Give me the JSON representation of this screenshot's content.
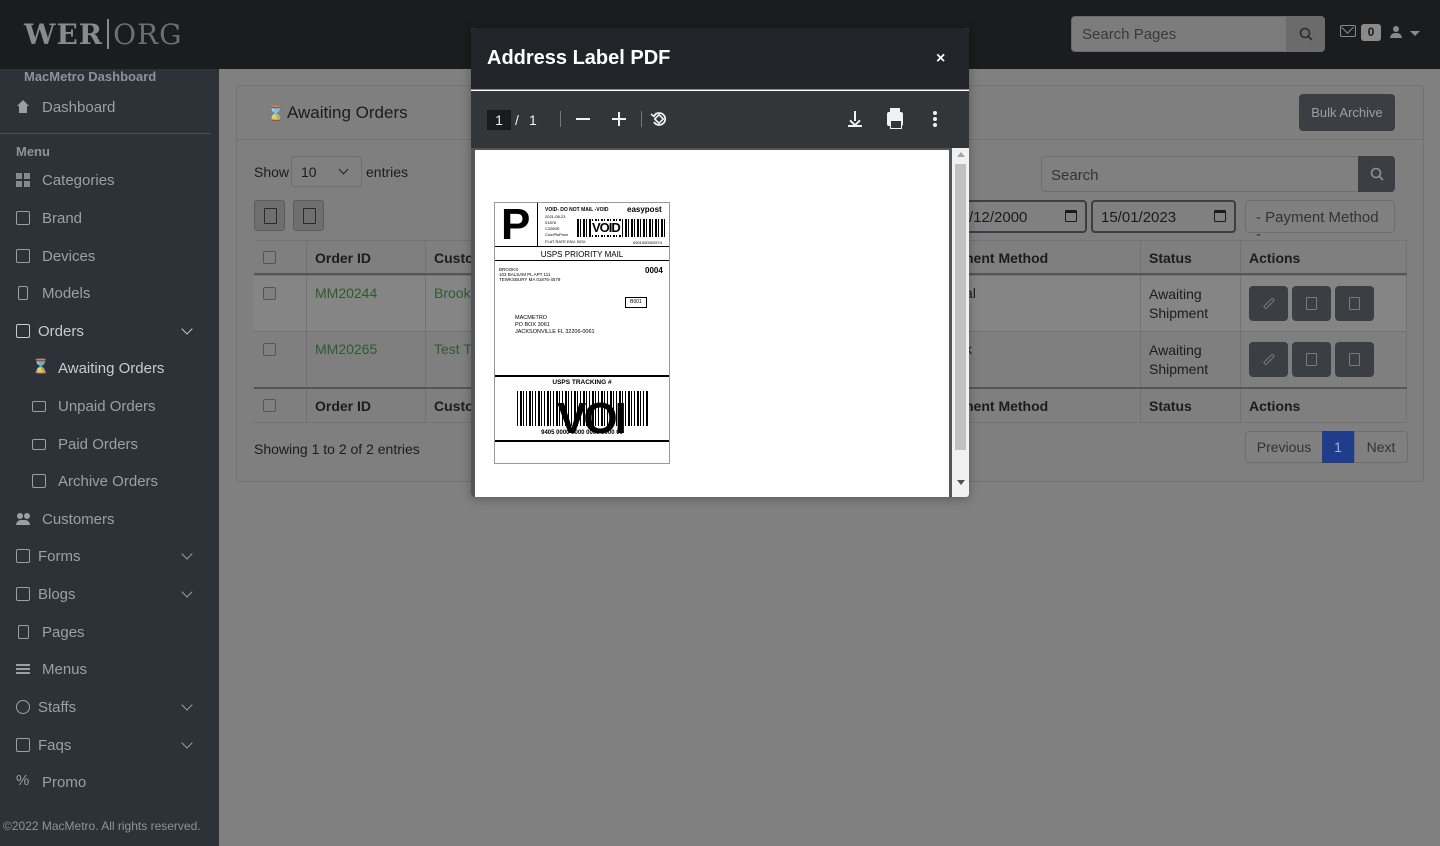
{
  "header": {
    "logo_left": "WER",
    "logo_right": "ORG",
    "search_placeholder": "Search Pages",
    "mail_count": "0"
  },
  "sidebar": {
    "brand": "MacMetro Dashboard",
    "dashboard": "Dashboard",
    "menu_label": "Menu",
    "items": [
      {
        "label": "Categories"
      },
      {
        "label": "Brand"
      },
      {
        "label": "Devices"
      },
      {
        "label": "Models"
      },
      {
        "label": "Orders"
      },
      {
        "label": "Awaiting Orders"
      },
      {
        "label": "Unpaid Orders"
      },
      {
        "label": "Paid Orders"
      },
      {
        "label": "Archive Orders"
      },
      {
        "label": "Customers"
      },
      {
        "label": "Forms"
      },
      {
        "label": "Blogs"
      },
      {
        "label": "Pages"
      },
      {
        "label": "Menus"
      },
      {
        "label": "Staffs"
      },
      {
        "label": "Faqs"
      },
      {
        "label": "Promo"
      }
    ],
    "copyright": "©2022 MacMetro. All rights reserved."
  },
  "main": {
    "title": "Awaiting Orders",
    "bulk_archive": "Bulk Archive",
    "show": "Show",
    "entries_value": "10",
    "entries": "entries",
    "search_placeholder": "Search",
    "date_from": "/12/2000",
    "date_to": "15/01/2023",
    "payment_method": "- Payment Method -",
    "columns": {
      "order_id": "Order ID",
      "customer": "Custo",
      "payment": "nent Method",
      "status": "Status",
      "actions": "Actions"
    },
    "rows": [
      {
        "order_id": "MM20244",
        "customer": "Brooks",
        "payment": "al",
        "status_1": "Awaiting",
        "status_2": "Shipment"
      },
      {
        "order_id": "MM20265",
        "customer": "Test To",
        "payment": "k",
        "status_1": "Awaiting",
        "status_2": "Shipment"
      }
    ],
    "showing": "Showing 1 to 2 of 2 entries",
    "pagination": {
      "previous": "Previous",
      "page": "1",
      "next": "Next"
    }
  },
  "modal": {
    "title": "Address Label PDF",
    "close": "×",
    "pdf": {
      "page": "1",
      "separator": "/",
      "total": "1"
    },
    "label": {
      "carrier_letter": "P",
      "void_text": "VOID- DO NOT MAIL -VOID",
      "brand": "easypost",
      "meta_lines": [
        "2021-08-23",
        "01876",
        "C2060S",
        "ComPlsPrice",
        "FLAT RATE ENV. BOX"
      ],
      "meta_id": "0901000002974",
      "void_stamp": "VOID",
      "service": "USPS PRIORITY MAIL",
      "from_lines": [
        "BROOKS",
        "103 BALSAM PL APT 111",
        "TEWKSBURY MA 01876-4579"
      ],
      "code": "0004",
      "box": "B001",
      "to_lines": [
        "MACMETRO",
        "PO BOX 3061",
        "JACKSONVILLE FL 32206-0061"
      ],
      "tracking_title": "USPS TRACKING #",
      "tracking_stamp": "VOI",
      "tracking_number": "9405 0000 0000 0000 0000 00"
    }
  }
}
